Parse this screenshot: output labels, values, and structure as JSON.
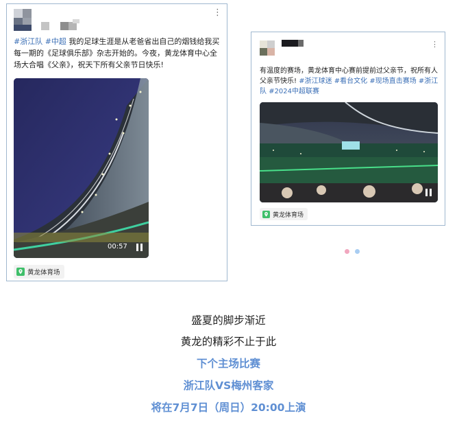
{
  "post1": {
    "more_icon": "more-vertical-icon",
    "tags": [
      "#浙江队",
      "#中超"
    ],
    "text": " 我的足球生涯是从老爸省出自己的烟钱给我买每一期的《足球俱乐部》杂志开始的。今夜，黄龙体育中心全场大合唱《父亲》，祝天下所有父亲节日快乐!",
    "video": {
      "duration": "00:57",
      "control_icon": "pause-icon"
    },
    "location": {
      "icon": "location-pin-icon",
      "label": "黄龙体育场"
    }
  },
  "post2": {
    "more_icon": "more-vertical-icon",
    "text": "有温度的赛场，黄龙体育中心赛前提前过父亲节，祝所有人父亲节快乐! ",
    "tags": [
      "#浙江球迷",
      "#看台文化",
      "#现场直击赛场",
      "#浙江队",
      "#2024中超联赛"
    ],
    "video": {
      "control_icon": "pause-icon"
    },
    "location": {
      "icon": "location-pin-icon",
      "label": "黄龙体育场"
    }
  },
  "carousel": {
    "dots": 2,
    "active_index": 1,
    "colors": {
      "inactive": "#f1a7bf",
      "active": "#a9cdf2"
    }
  },
  "announcement": {
    "line1": "盛夏的脚步渐近",
    "line2": "黄龙的精彩不止于此",
    "line3": "下个主场比赛",
    "line4": "浙江队VS梅州客家",
    "line5": "将在7月7日（周日）20:00上演"
  },
  "colors": {
    "tag": "#3b6fb6",
    "accent_blue": "#5f8fd3",
    "card_border": "#9fb7cf",
    "location_green": "#3fbf6a"
  }
}
